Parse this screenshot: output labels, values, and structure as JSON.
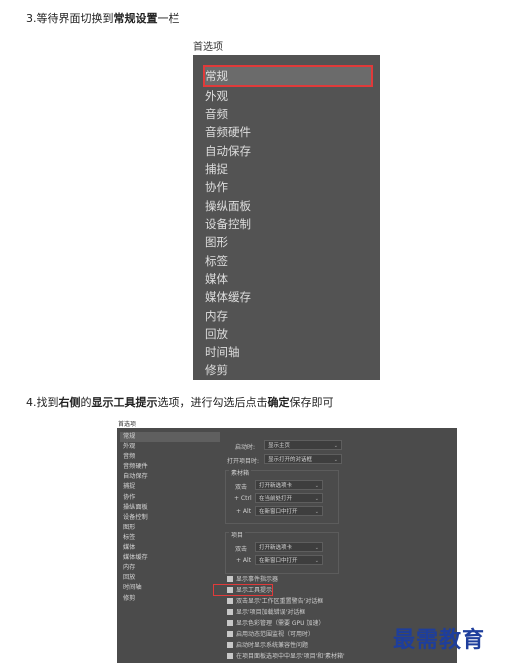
{
  "step3": {
    "prefix": "3.等待界面切换到",
    "emph": "常规设置",
    "suffix": "一栏"
  },
  "shot1": {
    "title": "首选项",
    "items": [
      "常规",
      "外观",
      "音频",
      "音频硬件",
      "自动保存",
      "捕捉",
      "协作",
      "操纵面板",
      "设备控制",
      "图形",
      "标签",
      "媒体",
      "媒体缓存",
      "内存",
      "回放",
      "时间轴",
      "修剪"
    ]
  },
  "step4": {
    "p1": "4.找到",
    "b1": "右侧",
    "p2": "的",
    "b2": "显示工具提示",
    "p3": "选项，进行勾选后点击",
    "b3": "确定",
    "p4": "保存即可"
  },
  "shot2": {
    "title": "首选项",
    "sidebar": [
      "常规",
      "外观",
      "音频",
      "音频硬件",
      "自动保存",
      "捕捉",
      "协作",
      "操纵面板",
      "设备控制",
      "图形",
      "标签",
      "媒体",
      "媒体缓存",
      "内存",
      "回放",
      "时间轴",
      "修剪"
    ],
    "startup_label": "启动时:",
    "startup_value": "显示主页",
    "open_project_label": "打开项目时:",
    "open_project_value": "显示打开的对话框",
    "bin_label": "素材箱",
    "bin_dbl_label": "双击",
    "bin_dbl_value": "打开新选项卡",
    "bin_ctrl_label": "+ Ctrl",
    "bin_ctrl_value": "在当前处打开",
    "bin_alt_label": "+ Alt",
    "bin_alt_value": "在新窗口中打开",
    "project_label": "项目",
    "proj_dbl_label": "双击",
    "proj_dbl_value": "打开新选项卡",
    "proj_alt_label": "+ Alt",
    "proj_alt_value": "在新窗口中打开",
    "checkboxes": [
      "显示事件指示器",
      "显示工具提示",
      "双击显示'工作区重置警告'对话框",
      "显示'项目加载错误'对话框",
      "显示色彩管理（需要 GPU 加速）",
      "启用动态范围监视（可用时）",
      "启动时显示系统兼容性问题",
      "在项目面板选项中中显示'项目'和'素材箱'"
    ]
  },
  "watermark": "最需教育"
}
